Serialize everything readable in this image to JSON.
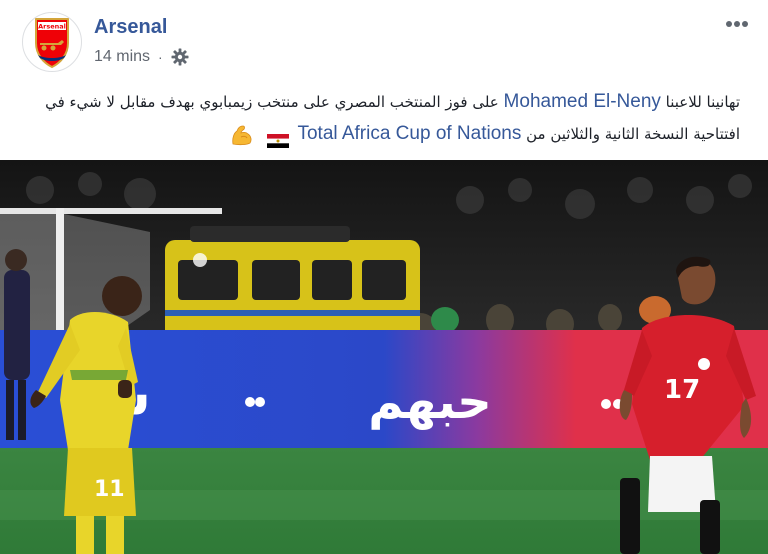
{
  "post": {
    "page_name": "Arsenal",
    "timestamp": "14 mins",
    "privacy_icon": "gear-icon",
    "more_icon": "more-options-icon",
    "avatar_icon": "arsenal-crest-icon",
    "text": {
      "part1": "تهانينا للاعبنا",
      "mention": "Mohamed El-Neny",
      "part2": "على فوز المنتخب المصري على منتخب زيمبابوي بهدف مقابل لا شيء في افتتاحية النسخة الثانية والثلاثين من",
      "link": "Total Africa Cup of Nations",
      "emojis": [
        "egypt-flag",
        "flexed-biceps"
      ]
    }
  },
  "photo": {
    "banner_left_text": "شد",
    "banner_middle_text": "حبهم",
    "player_right_number": "17",
    "player_left_number": "11",
    "colors": {
      "banner_blue": "#2a4fd6",
      "banner_red": "#e0304a",
      "pitch_green": "#3f8a45",
      "kit_yellow": "#e8d52a",
      "kit_red": "#d61f2c",
      "brand_blue": "#365899"
    }
  }
}
